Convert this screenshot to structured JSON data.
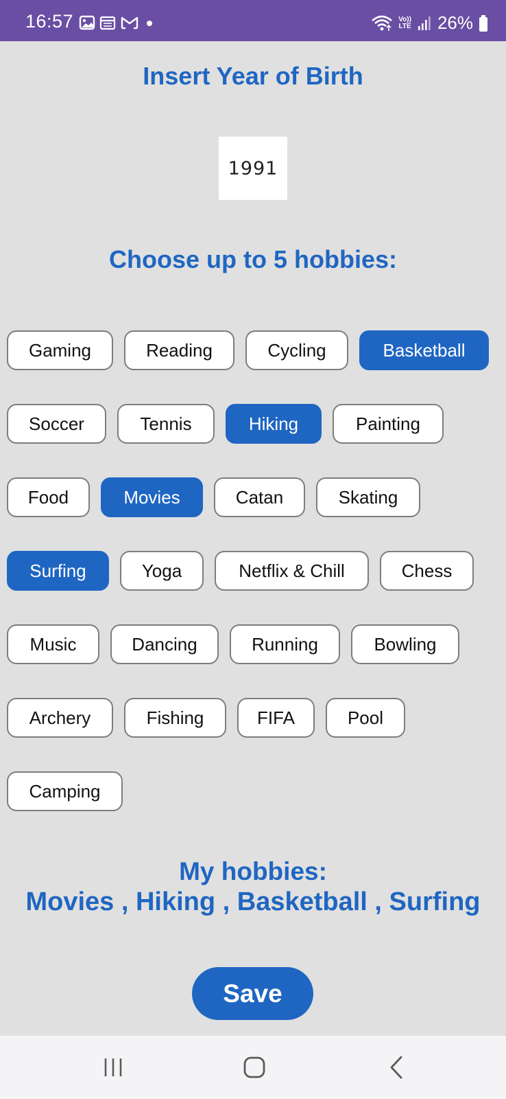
{
  "status_bar": {
    "time": "16:57",
    "battery": "26%",
    "left_icons": [
      "image-icon",
      "calendar-icon",
      "gmail-icon",
      "dot-icon"
    ],
    "right_icons": [
      "wifi-icon",
      "volte-icon",
      "signal-icon",
      "battery-icon"
    ],
    "volte_top": "Vo))",
    "volte_bottom": "LTE"
  },
  "year_section": {
    "title": "Insert Year of Birth",
    "value": "1991"
  },
  "hobbies_section": {
    "title": "Choose up to 5 hobbies:",
    "rows": [
      [
        {
          "label": "Gaming",
          "selected": false
        },
        {
          "label": "Reading",
          "selected": false
        },
        {
          "label": "Cycling",
          "selected": false
        },
        {
          "label": "Basketball",
          "selected": true
        }
      ],
      [
        {
          "label": "Soccer",
          "selected": false
        },
        {
          "label": "Tennis",
          "selected": false
        },
        {
          "label": "Hiking",
          "selected": true
        },
        {
          "label": "Painting",
          "selected": false
        }
      ],
      [
        {
          "label": "Food",
          "selected": false
        },
        {
          "label": "Movies",
          "selected": true
        },
        {
          "label": "Catan",
          "selected": false
        },
        {
          "label": "Skating",
          "selected": false
        }
      ],
      [
        {
          "label": "Surfing",
          "selected": true
        },
        {
          "label": "Yoga",
          "selected": false
        },
        {
          "label": "Netflix & Chill",
          "selected": false
        },
        {
          "label": "Chess",
          "selected": false
        }
      ],
      [
        {
          "label": "Music",
          "selected": false
        },
        {
          "label": "Dancing",
          "selected": false
        },
        {
          "label": "Running",
          "selected": false
        },
        {
          "label": "Bowling",
          "selected": false
        }
      ],
      [
        {
          "label": "Archery",
          "selected": false
        },
        {
          "label": "Fishing",
          "selected": false
        },
        {
          "label": "FIFA",
          "selected": false
        },
        {
          "label": "Pool",
          "selected": false
        }
      ],
      [
        {
          "label": "Camping",
          "selected": false
        }
      ]
    ]
  },
  "my_hobbies": {
    "label": "My hobbies:",
    "list": "Movies , Hiking , Basketball , Surfing"
  },
  "save_label": "Save",
  "nav_bar": {
    "icons": [
      "recent-apps-icon",
      "home-icon",
      "back-icon"
    ]
  },
  "colors": {
    "accent": "#1f66c2",
    "status_bar": "#6a4ea3",
    "background": "#e0e0e0"
  }
}
